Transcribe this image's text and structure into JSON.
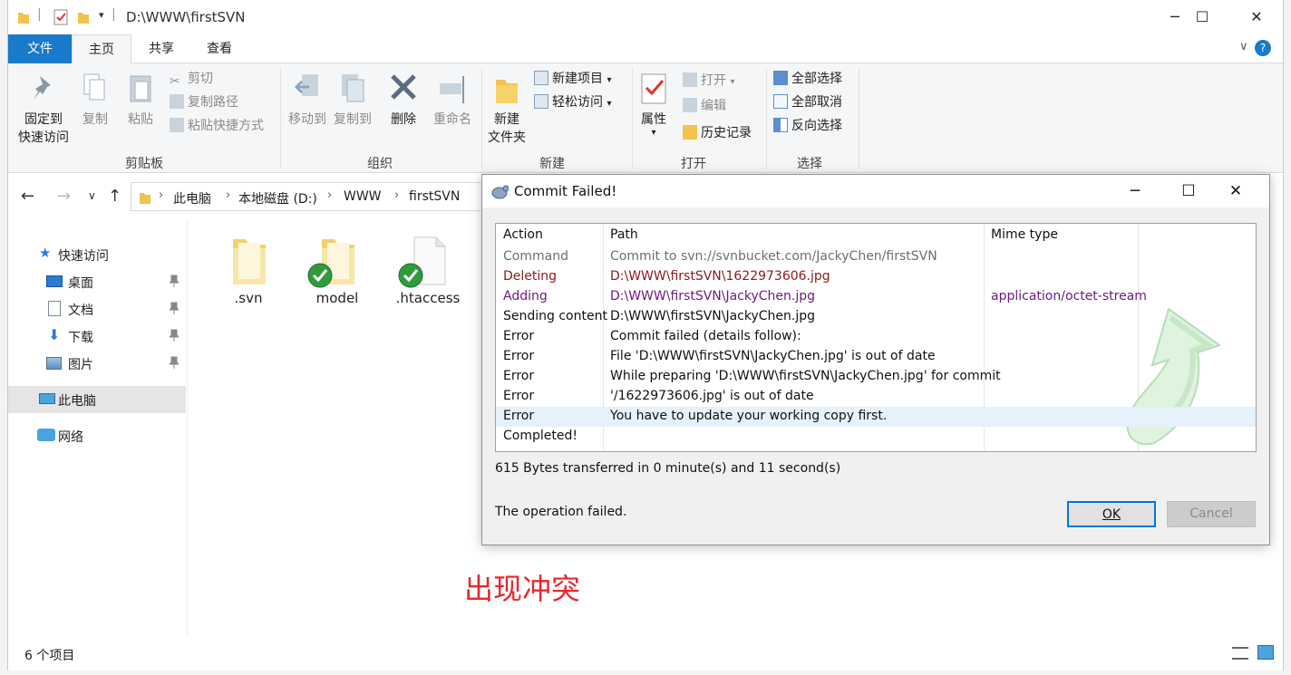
{
  "explorer": {
    "title": "D:\\WWW\\firstSVN",
    "tabs": {
      "file": "文件",
      "home": "主页",
      "share": "共享",
      "view": "查看"
    },
    "ribbon": {
      "clipboard": {
        "group": "剪贴板",
        "pin_line1": "固定到",
        "pin_line2": "快速访问",
        "copy": "复制",
        "paste": "粘贴",
        "cut": "剪切",
        "copy_path": "复制路径",
        "paste_shortcut": "粘贴快捷方式"
      },
      "organize": {
        "group": "组织",
        "move_to": "移动到",
        "copy_to": "复制到",
        "delete": "删除",
        "rename": "重命名"
      },
      "new": {
        "group": "新建",
        "new_folder_line1": "新建",
        "new_folder_line2": "文件夹",
        "new_item": "新建项目",
        "easy_access": "轻松访问"
      },
      "open": {
        "group": "打开",
        "properties": "属性",
        "open": "打开",
        "edit": "编辑",
        "history": "历史记录"
      },
      "select": {
        "group": "选择",
        "select_all": "全部选择",
        "select_none": "全部取消",
        "invert": "反向选择"
      }
    },
    "breadcrumb": [
      "此电脑",
      "本地磁盘 (D:)",
      "WWW",
      "firstSVN"
    ],
    "nav": {
      "quick_access": "快速访问",
      "desktop": "桌面",
      "documents": "文档",
      "downloads": "下载",
      "pictures": "图片",
      "this_pc": "此电脑",
      "network": "网络"
    },
    "files": [
      {
        "name": ".svn",
        "kind": "folder",
        "badge": "none"
      },
      {
        "name": "model",
        "kind": "folder",
        "badge": "ok"
      },
      {
        "name": ".htaccess",
        "kind": "file",
        "badge": "ok"
      }
    ],
    "status": "6 个项目"
  },
  "dialog": {
    "title": "Commit Failed!",
    "columns": {
      "action": "Action",
      "path": "Path",
      "mime": "Mime type"
    },
    "rows": [
      {
        "action": "Command",
        "path": "Commit to svn://svnbucket.com/JackyChen/firstSVN",
        "mime": "",
        "kind": "command"
      },
      {
        "action": "Deleting",
        "path": "D:\\WWW\\firstSVN\\1622973606.jpg",
        "mime": "",
        "kind": "deleting"
      },
      {
        "action": "Adding",
        "path": "D:\\WWW\\firstSVN\\JackyChen.jpg",
        "mime": "application/octet-stream",
        "kind": "adding"
      },
      {
        "action": "Sending content",
        "path": "D:\\WWW\\firstSVN\\JackyChen.jpg",
        "mime": "",
        "kind": "normal"
      },
      {
        "action": "Error",
        "path": "Commit failed (details follow):",
        "mime": "",
        "kind": "normal"
      },
      {
        "action": "Error",
        "path": "File 'D:\\WWW\\firstSVN\\JackyChen.jpg' is out of date",
        "mime": "",
        "kind": "normal"
      },
      {
        "action": "Error",
        "path": "While preparing 'D:\\WWW\\firstSVN\\JackyChen.jpg' for commit",
        "mime": "",
        "kind": "normal"
      },
      {
        "action": "Error",
        "path": "'/1622973606.jpg' is out of date",
        "mime": "",
        "kind": "normal"
      },
      {
        "action": "Error",
        "path": "You have to update your working copy first.",
        "mime": "",
        "kind": "selected"
      },
      {
        "action": "Completed!",
        "path": "",
        "mime": "",
        "kind": "normal"
      }
    ],
    "summary": "615 Bytes transferred in 0 minute(s) and 11 second(s)",
    "message": "The operation failed.",
    "ok": "OK",
    "cancel": "Cancel"
  },
  "annotation": "出现冲突",
  "colors": {
    "accent": "#1979ca",
    "annotation": "#e8262b",
    "deleting": "#8b1a1a",
    "adding": "#6a1b7a",
    "command": "#6e6e6e",
    "selected_row": "#e5f1fb"
  }
}
